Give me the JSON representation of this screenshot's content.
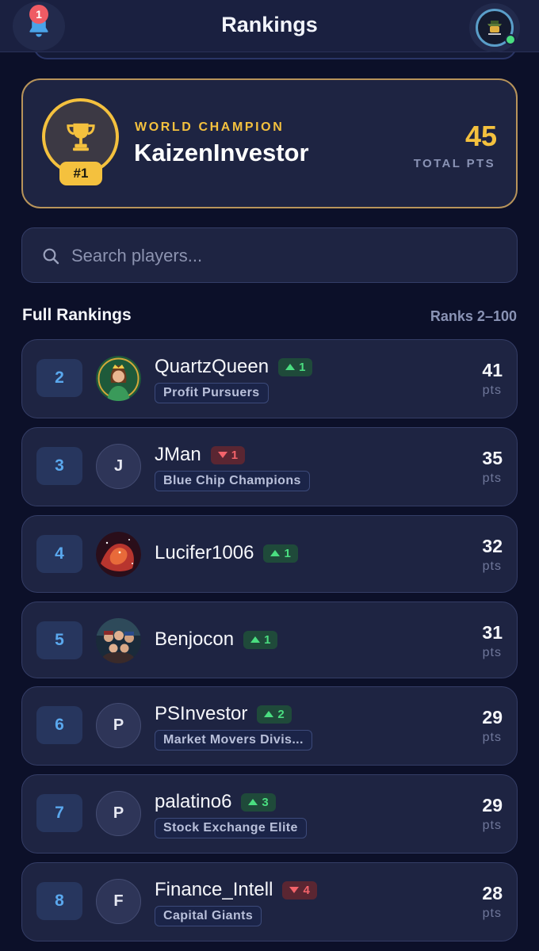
{
  "header": {
    "title": "Rankings",
    "notification_count": "1",
    "bell_icon": "bell-icon",
    "accent": "#f4c13e"
  },
  "champion": {
    "label": "WORLD CHAMPION",
    "name": "KaizenInvestor",
    "rank": "#1",
    "points": "45",
    "points_label": "TOTAL PTS",
    "icon": "trophy-icon"
  },
  "search": {
    "placeholder": "Search players...",
    "value": ""
  },
  "rankings": {
    "title": "Full Rankings",
    "range": "Ranks 2–100",
    "pts_label": "pts",
    "rows": [
      {
        "rank": "2",
        "name": "QuartzQueen",
        "delta": "1",
        "dir": "up",
        "team": "Profit Pursuers",
        "points": "41",
        "avatar": "image",
        "initial": ""
      },
      {
        "rank": "3",
        "name": "JMan",
        "delta": "1",
        "dir": "down",
        "team": "Blue Chip Champions",
        "points": "35",
        "avatar": "initial",
        "initial": "J"
      },
      {
        "rank": "4",
        "name": "Lucifer1006",
        "delta": "1",
        "dir": "up",
        "team": "",
        "points": "32",
        "avatar": "image",
        "initial": ""
      },
      {
        "rank": "5",
        "name": "Benjocon",
        "delta": "1",
        "dir": "up",
        "team": "",
        "points": "31",
        "avatar": "image",
        "initial": ""
      },
      {
        "rank": "6",
        "name": "PSInvestor",
        "delta": "2",
        "dir": "up",
        "team": "Market Movers Divis...",
        "points": "29",
        "avatar": "initial",
        "initial": "P"
      },
      {
        "rank": "7",
        "name": "palatino6",
        "delta": "3",
        "dir": "up",
        "team": "Stock Exchange Elite",
        "points": "29",
        "avatar": "initial",
        "initial": "P"
      },
      {
        "rank": "8",
        "name": "Finance_Intell",
        "delta": "4",
        "dir": "down",
        "team": "Capital Giants",
        "points": "28",
        "avatar": "initial",
        "initial": "F"
      }
    ]
  }
}
